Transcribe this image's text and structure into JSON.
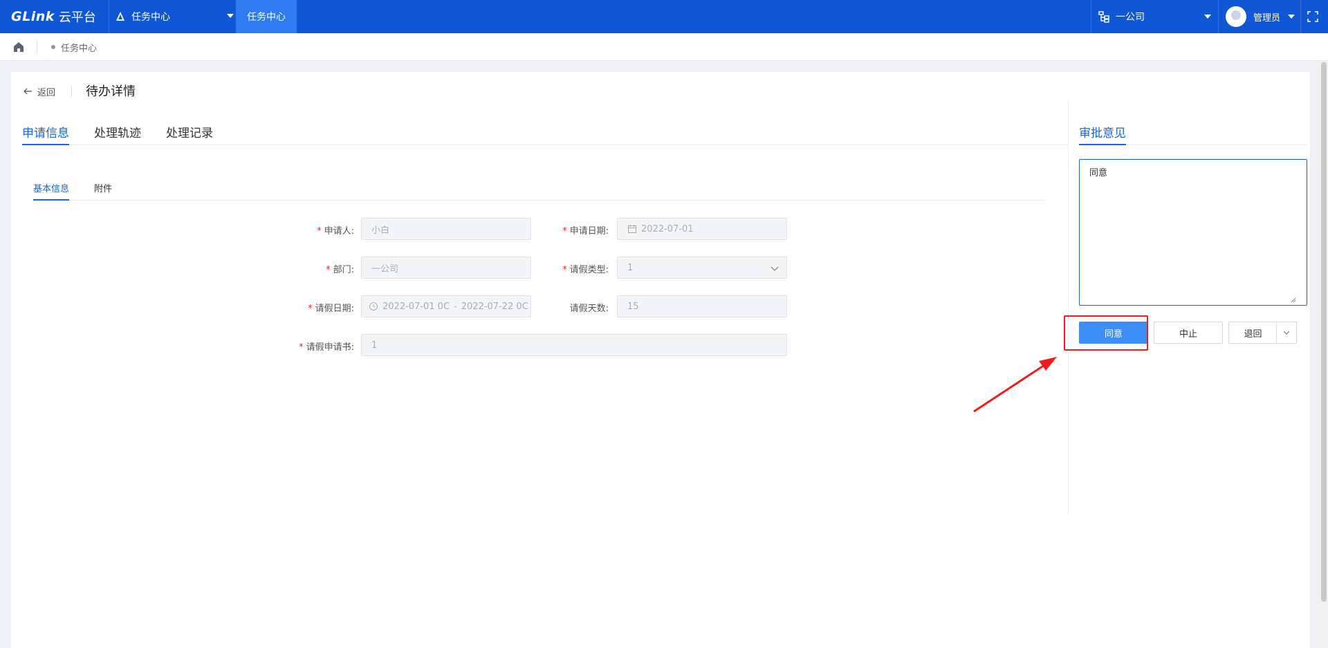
{
  "topbar": {
    "brand": "GLink",
    "brand_sub": "云平台",
    "app_switch_label": "任务中心",
    "active_tab": "任务中心",
    "org_label": "一公司",
    "user_label": "管理员",
    "accent_color": "#1057d5"
  },
  "breadcrumb": {
    "current": "任务中心"
  },
  "header": {
    "back_label": "返回",
    "page_title": "待办详情"
  },
  "tabs": [
    "申请信息",
    "处理轨迹",
    "处理记录"
  ],
  "subtabs": [
    "基本信息",
    "附件"
  ],
  "form": {
    "applicant_label": "申请人:",
    "applicant_value": "小白",
    "apply_date_label": "申请日期:",
    "apply_date_value": "2022-07-01",
    "dept_label": "部门:",
    "dept_value": "一公司",
    "leave_type_label": "请假类型:",
    "leave_type_value": "1",
    "leave_date_label": "请假日期:",
    "leave_date_start": "2022-07-01 0C",
    "leave_date_end": "2022-07-22 0C",
    "leave_days_label": "请假天数:",
    "leave_days_value": "15",
    "leave_letter_label": "请假申请书:",
    "leave_letter_value": "1"
  },
  "approval": {
    "title": "审批意见",
    "opinion_value": "同意",
    "agree_label": "同意",
    "stop_label": "中止",
    "return_label": "退回"
  },
  "annotation_color": "#f21b1b"
}
